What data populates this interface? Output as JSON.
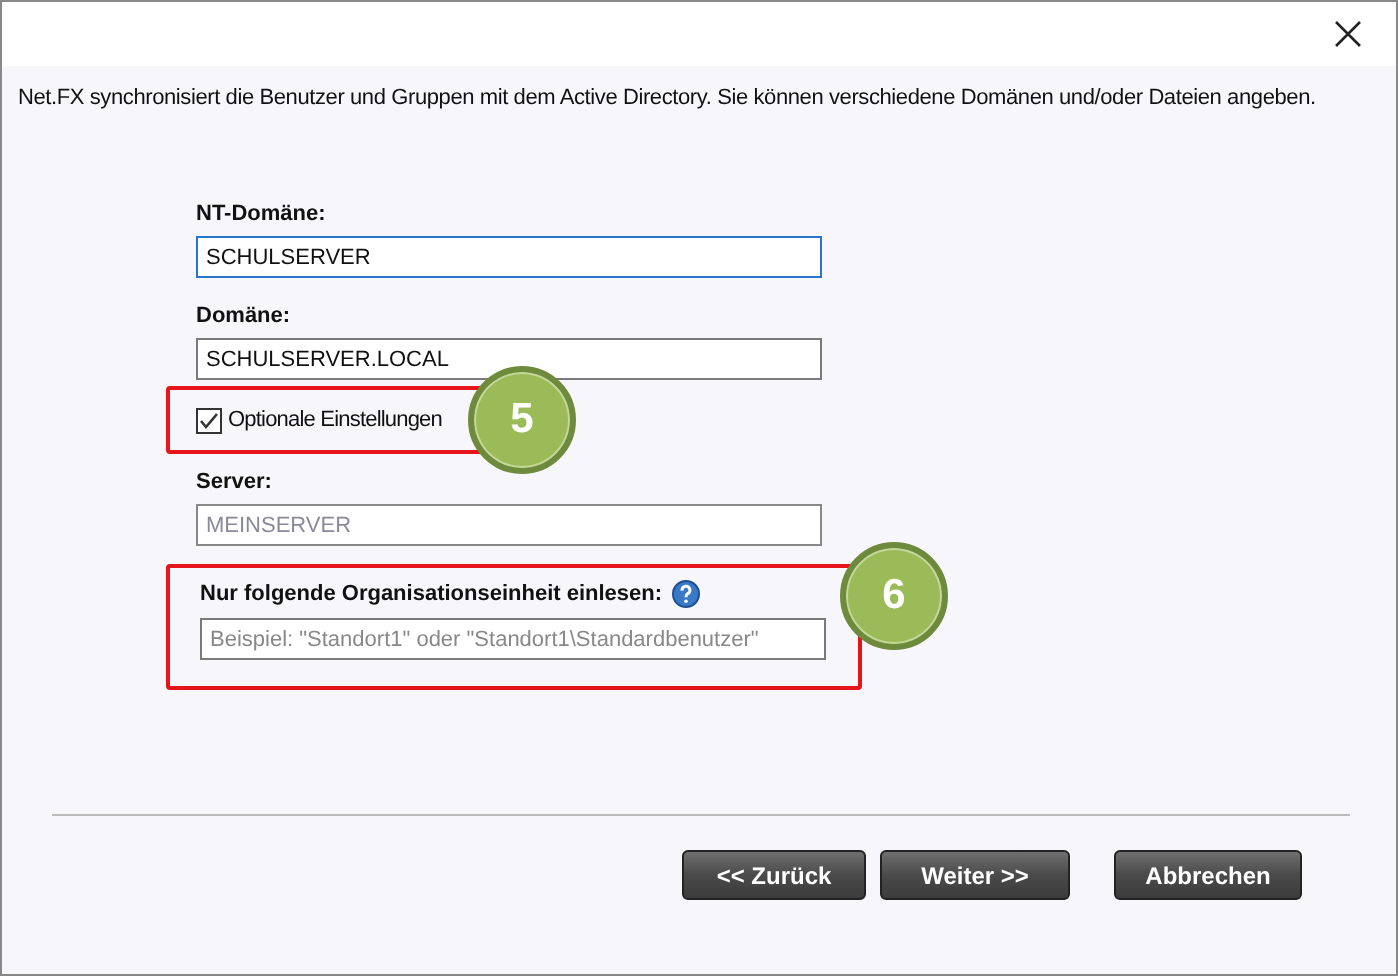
{
  "intro": "Net.FX synchronisiert die Benutzer und Gruppen mit dem Active Directory. Sie können verschiedene Domänen und/oder Dateien angeben.",
  "nt_domain": {
    "label": "NT-Domäne:",
    "value": "SCHULSERVER",
    "focused": true
  },
  "domain": {
    "label": "Domäne:",
    "value": "SCHULSERVER.LOCAL"
  },
  "optional_settings": {
    "label": "Optionale Einstellungen",
    "checked": true
  },
  "server": {
    "label": "Server:",
    "value": "MEINSERVER",
    "disabled": true
  },
  "ou": {
    "label": "Nur folgende Organisationseinheit einlesen:",
    "placeholder": "Beispiel: \"Standort1\" oder \"Standort1\\Standardbenutzer\""
  },
  "callouts": [
    "5",
    "6"
  ],
  "buttons": [
    {
      "label": "<< Zurück",
      "kind": "back"
    },
    {
      "label": "Weiter >>",
      "kind": "next"
    },
    {
      "label": "Abbrechen",
      "kind": "cancel"
    }
  ]
}
